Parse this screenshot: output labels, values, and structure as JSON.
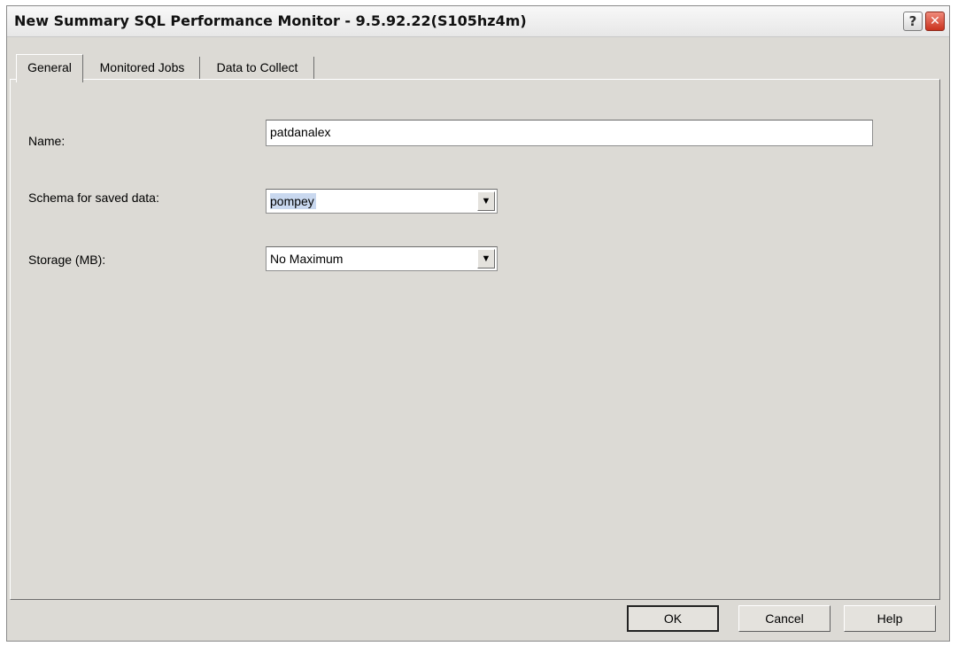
{
  "window": {
    "title": "New Summary SQL Performance Monitor - 9.5.92.22(S105hz4m)",
    "help_glyph": "?",
    "close_glyph": "✕"
  },
  "tabs": [
    {
      "label": "General",
      "active": true
    },
    {
      "label": "Monitored Jobs",
      "active": false
    },
    {
      "label": "Data to Collect",
      "active": false
    }
  ],
  "form": {
    "name_label": "Name:",
    "name_value": "patdanalex",
    "schema_label": "Schema for saved data:",
    "schema_value": "pompey",
    "storage_label": "Storage (MB):",
    "storage_value": "No Maximum",
    "dropdown_glyph": "▼"
  },
  "buttons": {
    "ok": "OK",
    "cancel": "Cancel",
    "help": "Help"
  },
  "colors": {
    "dialog_background": "#dcdad5",
    "close_button": "#c9321e",
    "selection_highlight": "#c9d8ef"
  },
  "icons": [
    "help-icon",
    "close-icon",
    "chevron-down-icon"
  ]
}
